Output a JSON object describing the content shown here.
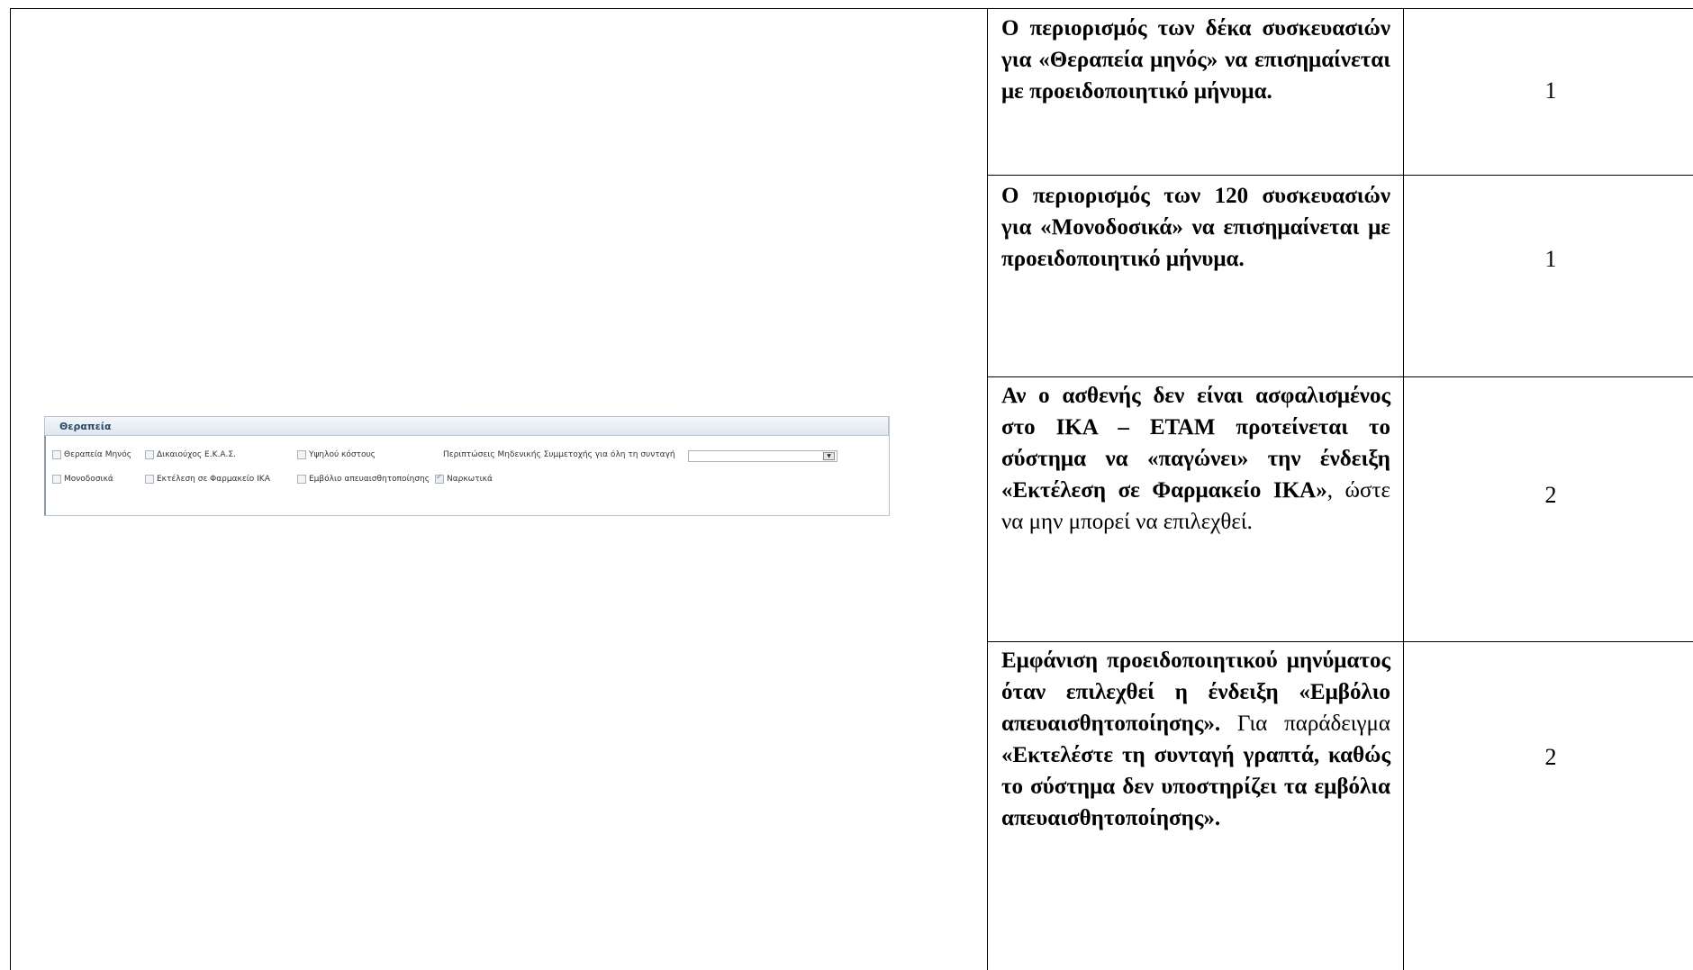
{
  "requirements": [
    {
      "segments": [
        {
          "text": "Ο περιορισμός των δέκα συσκευασιών για «Θεραπεία μηνός» να επισημαίνεται με προειδοποιητικό μήνυμα.",
          "bold": true
        }
      ],
      "priority": "1"
    },
    {
      "segments": [
        {
          "text": "Ο περιορισμός των 120 συσκευασιών για «Μονοδοσικά» να επισημαίνεται με προειδοποιητικό μήνυμα.",
          "bold": true
        }
      ],
      "priority": "1"
    },
    {
      "segments": [
        {
          "text": "Αν ο ασθενής δεν είναι ασφαλισμένος στο ΙΚΑ – ΕΤΑΜ προτείνεται το σύστημα να «παγώνει» την ένδειξη «Εκτέλεση σε Φαρμακείο ΙΚΑ»",
          "bold": true
        },
        {
          "text": ", ώστε να μην μπορεί να επιλεχθεί.",
          "bold": false
        }
      ],
      "priority": "2"
    },
    {
      "segments": [
        {
          "text": "Εμφάνιση προειδοποιητικού μηνύματος όταν επιλεχθεί η ένδειξη «Εμβόλιο απευαισθητοποίησης».",
          "bold": true
        },
        {
          "text": " Για παράδειγμα ",
          "bold": false
        },
        {
          "text": "«Εκτελέστε τη συνταγή γραπτά, καθώς το σύστημα δεν υποστηρίζει τα εμβόλια απευαισθητοποίησης».",
          "bold": true
        }
      ],
      "priority": "2"
    }
  ],
  "screenshot": {
    "panel_title": "Θεραπεία",
    "row1": {
      "therapy_month": "Θεραπεία Μηνός",
      "ekas": "Δικαιούχος Ε.Κ.Α.Σ.",
      "high_cost": "Υψηλού κόστους",
      "zero_copay_label": "Περιπτώσεις Μηδενικής Συμμετοχής για όλη τη συνταγή",
      "zero_copay_value": ""
    },
    "row2": {
      "single_dose": "Μονοδοσικά",
      "ika_pharmacy": "Εκτέλεση σε Φαρμακείο ΙΚΑ",
      "vaccine": "Εμβόλιο απευαισθητοποίησης",
      "narcotics": "Ναρκωτικά"
    },
    "narcotics_checked": true
  }
}
